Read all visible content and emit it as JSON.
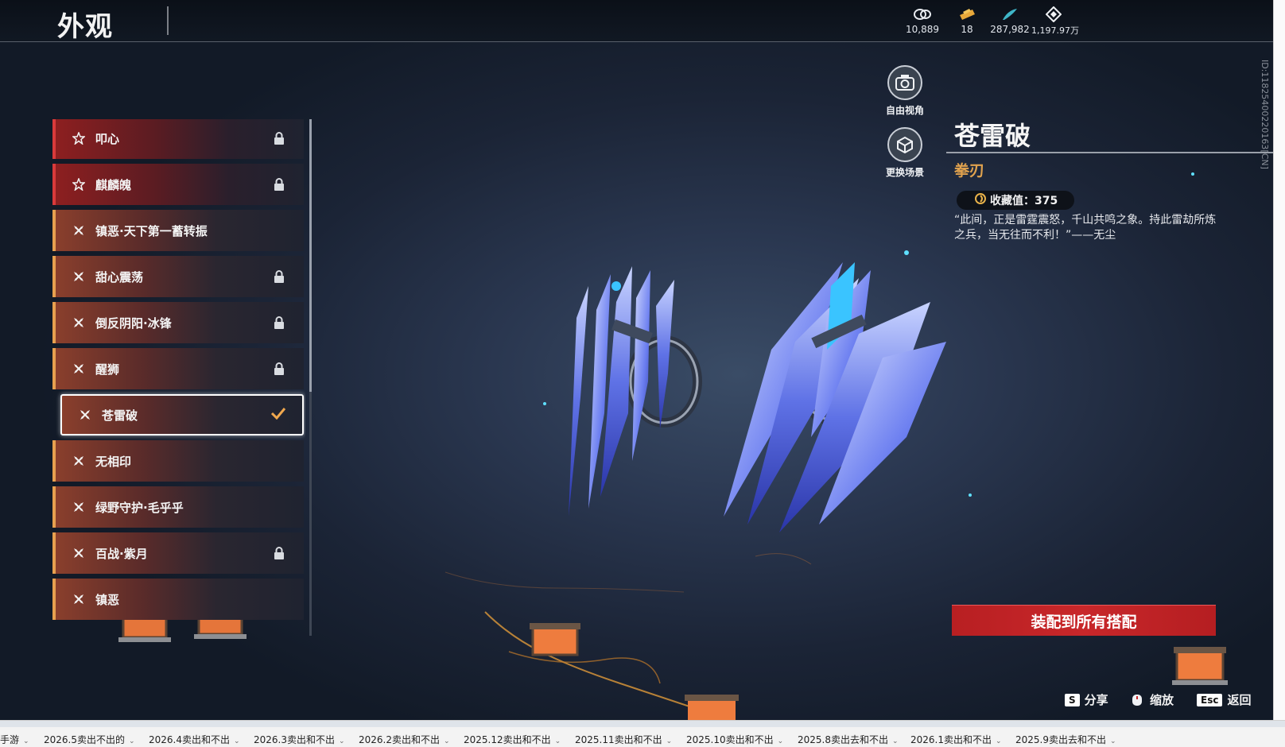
{
  "header": {
    "title": "外观",
    "currencies": [
      {
        "icon": "coin-stack-icon",
        "value": "10,889"
      },
      {
        "icon": "ticket-icon",
        "value": "18"
      },
      {
        "icon": "feather-icon",
        "value": "287,982"
      },
      {
        "icon": "diamond-icon",
        "value": "1,197.97万"
      }
    ]
  },
  "skins": [
    {
      "label": "叩心",
      "icon": "star-icon",
      "style": "red",
      "locked": true,
      "selected": false
    },
    {
      "label": "麒麟魄",
      "icon": "star-icon",
      "style": "red",
      "locked": true,
      "selected": false
    },
    {
      "label": "镇恶·天下第一蓄转振",
      "icon": "cross-icon",
      "style": "orange",
      "locked": false,
      "selected": false
    },
    {
      "label": "甜心震荡",
      "icon": "cross-icon",
      "style": "orange",
      "locked": true,
      "selected": false
    },
    {
      "label": "倒反阴阳·冰锋",
      "icon": "cross-icon",
      "style": "orange",
      "locked": true,
      "selected": false
    },
    {
      "label": "醒狮",
      "icon": "cross-icon",
      "style": "orange",
      "locked": true,
      "selected": false
    },
    {
      "label": "苍雷破",
      "icon": "cross-icon",
      "style": "orange",
      "locked": false,
      "selected": true
    },
    {
      "label": "无相印",
      "icon": "cross-icon",
      "style": "orange",
      "locked": false,
      "selected": false
    },
    {
      "label": "绿野守护·毛乎乎",
      "icon": "cross-icon",
      "style": "orange",
      "locked": false,
      "selected": false
    },
    {
      "label": "百战·紫月",
      "icon": "cross-icon",
      "style": "orange",
      "locked": true,
      "selected": false
    },
    {
      "label": "镇恶",
      "icon": "cross-icon",
      "style": "orange",
      "locked": false,
      "selected": false
    }
  ],
  "side_buttons": {
    "free_view": "自由视角",
    "change_scene": "更换场景"
  },
  "detail": {
    "name": "苍雷破",
    "type": "拳刃",
    "collect_value": "收藏值：375",
    "quote": "“此间，正是雷霆震怒，千山共鸣之象。持此雷劫所炼之兵，当无往而不利！”——无尘",
    "equip_button": "装配到所有搭配",
    "id_text": "ID:11825400220163[CN]"
  },
  "hints": [
    {
      "key": "S",
      "label": "分享"
    },
    {
      "key": "",
      "label": "缩放"
    },
    {
      "key": "Esc",
      "label": "返回"
    }
  ],
  "tabstrip": {
    "tabs": [
      "手游",
      "2026.5卖出不出的",
      "2026.4卖出和不出",
      "2026.3卖出和不出",
      "2026.2卖出和不出",
      "2025.12卖出和不出",
      "2025.11卖出和不出",
      "2025.10卖出和不出",
      "2025.8卖出去和不出",
      "2026.1卖出和不出",
      "2025.9卖出去和不出"
    ]
  },
  "colors": {
    "accent_red": "#c8272a",
    "accent_orange": "#e7a04f",
    "rarity_red": "#d93a3b"
  }
}
